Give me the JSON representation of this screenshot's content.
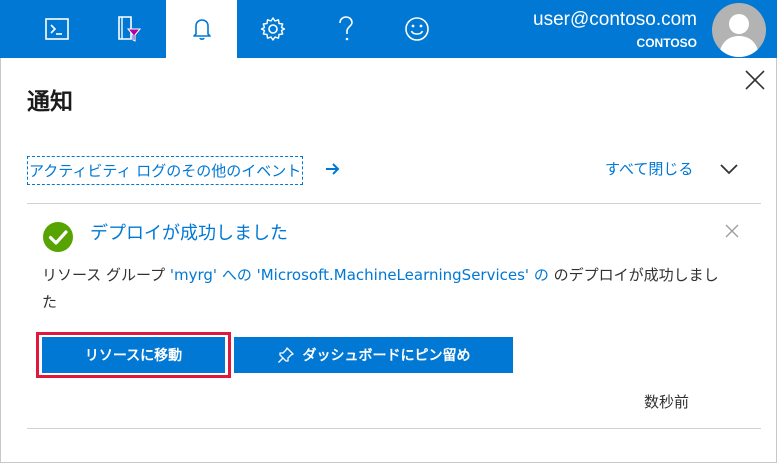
{
  "topbar": {
    "items": [
      {
        "name": "cloud-shell",
        "icon": "terminal-icon"
      },
      {
        "name": "directory-filter",
        "icon": "book-filter-icon"
      },
      {
        "name": "notifications",
        "icon": "bell-icon",
        "active": true
      },
      {
        "name": "settings",
        "icon": "gear-icon"
      },
      {
        "name": "help",
        "icon": "question-icon"
      },
      {
        "name": "feedback",
        "icon": "smiley-icon"
      }
    ],
    "user_email": "user@contoso.com",
    "user_org": "CONTOSO"
  },
  "panel": {
    "title": "通知",
    "activity_link": "アクティビティ ログのその他のイベント",
    "dismiss_all": "すべて閉じる"
  },
  "notification": {
    "title": "デプロイが成功しました",
    "body_prefix": "リソース グループ ",
    "resource_group": "'myrg'",
    "body_mid": " への ",
    "resource": "'Microsoft.MachineLearningServices'",
    "body_suffix": " のデプロイが成功しました",
    "go_to_resource": "リソースに移動",
    "pin_to_dashboard": "ダッシュボードにピン留め",
    "timestamp": "数秒前"
  },
  "colors": {
    "brand": "#0078d4",
    "success": "#57a300",
    "focus": "#e0183c"
  }
}
